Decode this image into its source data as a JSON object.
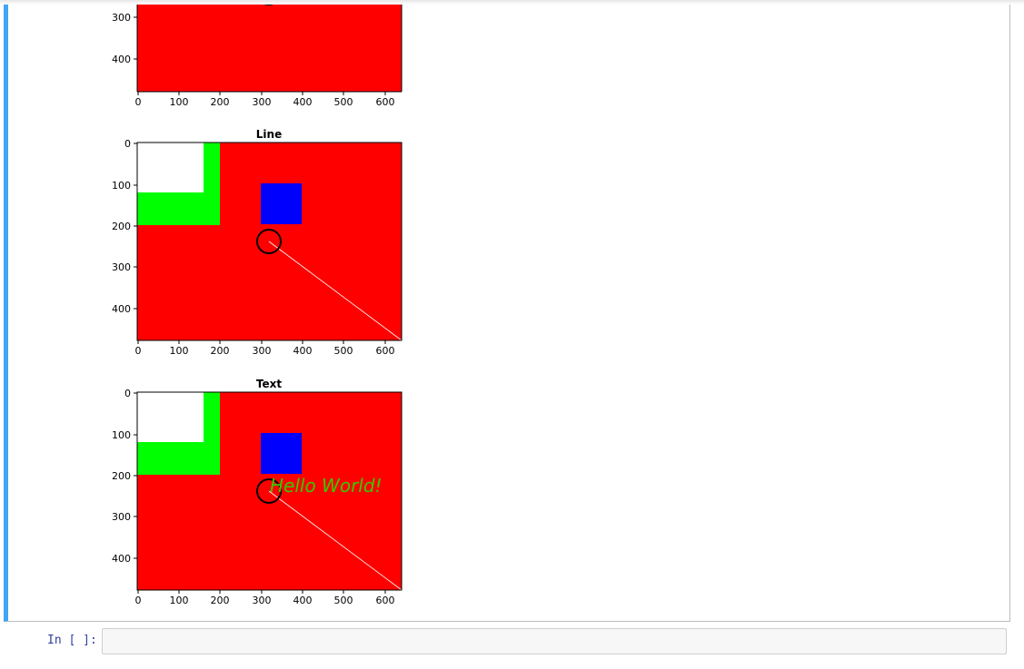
{
  "notebook": {
    "empty_cell": {
      "prompt": "In [ ]:",
      "value": ""
    }
  },
  "chart_data": [
    {
      "type": "image",
      "title": "",
      "x_ticks": [
        "0",
        "100",
        "200",
        "300",
        "400",
        "500",
        "600"
      ],
      "y_ticks": [
        "300",
        "400"
      ],
      "xlim": [
        0,
        640
      ],
      "ylim": [
        480,
        0
      ],
      "visible_partial": true
    },
    {
      "type": "image",
      "title": "Line",
      "x_ticks": [
        "0",
        "100",
        "200",
        "300",
        "400",
        "500",
        "600"
      ],
      "y_ticks": [
        "0",
        "100",
        "200",
        "300",
        "400"
      ],
      "xlim": [
        0,
        640
      ],
      "ylim": [
        480,
        0
      ]
    },
    {
      "type": "image",
      "title": "Text",
      "x_ticks": [
        "0",
        "100",
        "200",
        "300",
        "400",
        "500",
        "600"
      ],
      "y_ticks": [
        "0",
        "100",
        "200",
        "300",
        "400"
      ],
      "xlim": [
        0,
        640
      ],
      "ylim": [
        480,
        0
      ],
      "annotation": {
        "text": "Hello World!",
        "color": "#33cc00"
      }
    }
  ],
  "image_colors": {
    "background": "#ff0000",
    "white": "#ffffff",
    "green": "#00ff00",
    "blue": "#0000ff",
    "circle": "#000000",
    "line": "#ffffff"
  }
}
